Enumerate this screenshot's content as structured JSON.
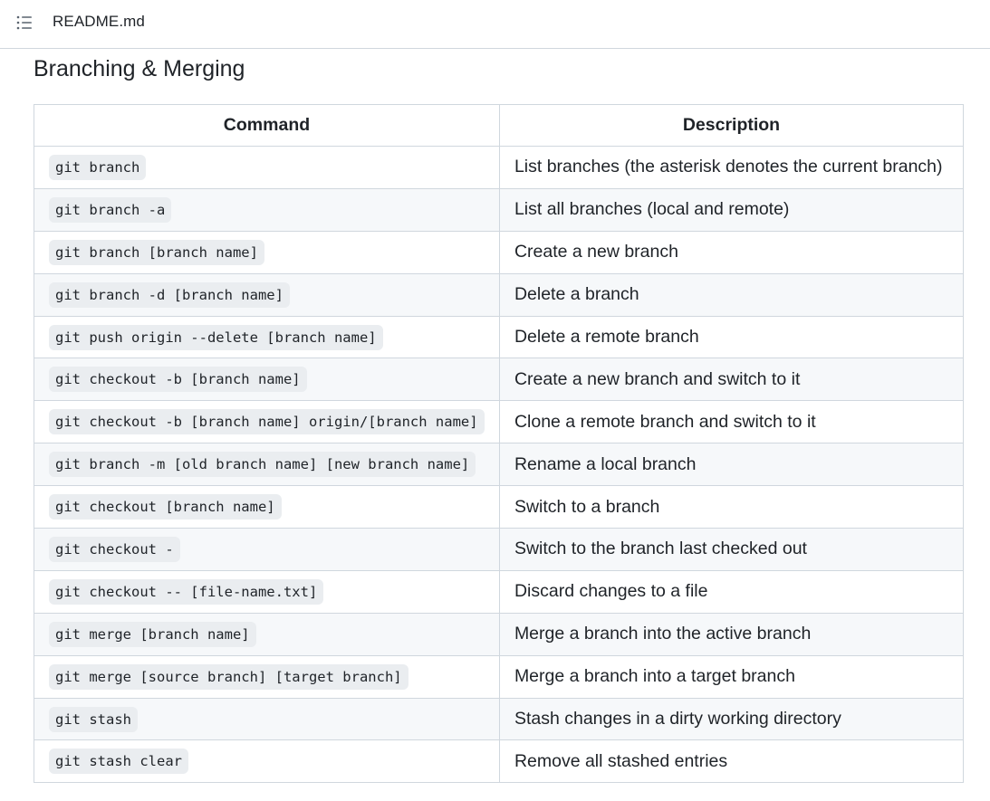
{
  "file_header": {
    "title": "README.md",
    "toc_icon": "list-unordered-icon"
  },
  "section": {
    "title": "Branching & Merging"
  },
  "table": {
    "headers": [
      "Command",
      "Description"
    ],
    "rows": [
      {
        "command": "git branch",
        "description": "List branches (the asterisk denotes the current branch)"
      },
      {
        "command": "git branch -a",
        "description": "List all branches (local and remote)"
      },
      {
        "command": "git branch [branch name]",
        "description": "Create a new branch"
      },
      {
        "command": "git branch -d [branch name]",
        "description": "Delete a branch"
      },
      {
        "command": "git push origin --delete [branch name]",
        "description": "Delete a remote branch"
      },
      {
        "command": "git checkout -b [branch name]",
        "description": "Create a new branch and switch to it"
      },
      {
        "command": "git checkout -b [branch name] origin/[branch name]",
        "description": "Clone a remote branch and switch to it"
      },
      {
        "command": "git branch -m [old branch name] [new branch name]",
        "description": "Rename a local branch"
      },
      {
        "command": "git checkout [branch name]",
        "description": "Switch to a branch"
      },
      {
        "command": "git checkout -",
        "description": "Switch to the branch last checked out"
      },
      {
        "command": "git checkout -- [file-name.txt]",
        "description": "Discard changes to a file"
      },
      {
        "command": "git merge [branch name]",
        "description": "Merge a branch into the active branch"
      },
      {
        "command": "git merge [source branch] [target branch]",
        "description": "Merge a branch into a target branch"
      },
      {
        "command": "git stash",
        "description": "Stash changes in a dirty working directory"
      },
      {
        "command": "git stash clear",
        "description": "Remove all stashed entries"
      }
    ]
  }
}
